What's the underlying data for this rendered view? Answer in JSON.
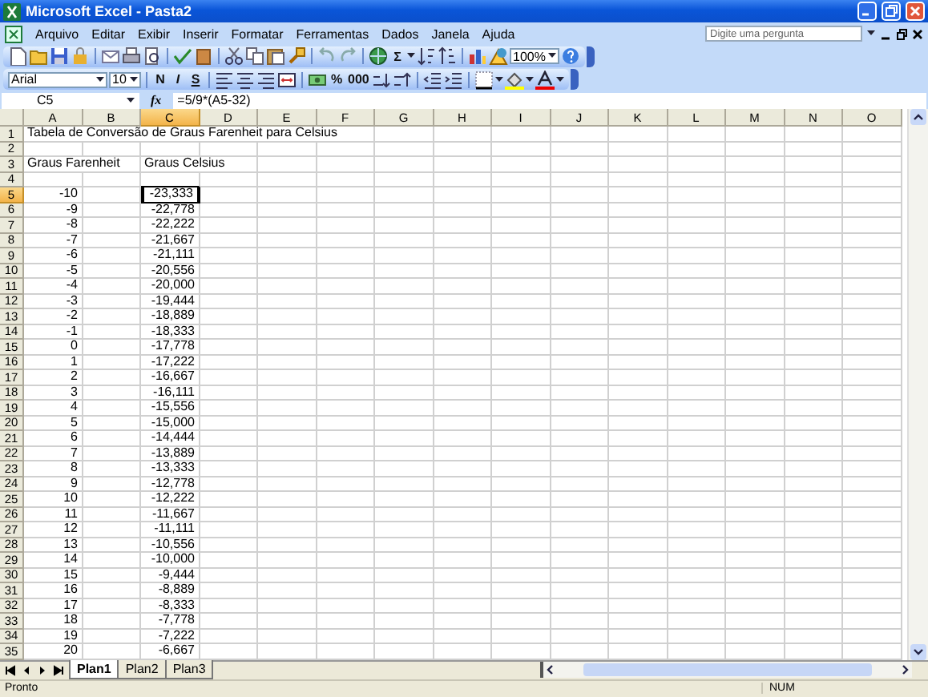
{
  "window": {
    "title": "Microsoft Excel - Pasta2"
  },
  "menu": [
    {
      "label": "Arquivo"
    },
    {
      "label": "Editar"
    },
    {
      "label": "Exibir"
    },
    {
      "label": "Inserir"
    },
    {
      "label": "Formatar"
    },
    {
      "label": "Ferramentas"
    },
    {
      "label": "Dados"
    },
    {
      "label": "Janela"
    },
    {
      "label": "Ajuda"
    }
  ],
  "help_box": {
    "placeholder": "Digite uma pergunta"
  },
  "standard_toolbar": {
    "sum": "Σ",
    "zoom": "100%"
  },
  "formatting_toolbar": {
    "font": "Arial",
    "size": "10",
    "bold": "N",
    "italic": "I",
    "underline": "S",
    "percent": "%",
    "thousands": "000"
  },
  "formula_bar": {
    "name_box": "C5",
    "fx": "fx",
    "formula": "=5/9*(A5-32)"
  },
  "sheet": {
    "columns": [
      {
        "label": "A",
        "selected": false
      },
      {
        "label": "B",
        "selected": false
      },
      {
        "label": "C",
        "selected": true
      },
      {
        "label": "D",
        "selected": false
      },
      {
        "label": "E",
        "selected": false
      },
      {
        "label": "F",
        "selected": false
      },
      {
        "label": "G",
        "selected": false
      },
      {
        "label": "H",
        "selected": false
      },
      {
        "label": "I",
        "selected": false
      },
      {
        "label": "J",
        "selected": false
      },
      {
        "label": "K",
        "selected": false
      },
      {
        "label": "L",
        "selected": false
      },
      {
        "label": "M",
        "selected": false
      },
      {
        "label": "N",
        "selected": false
      },
      {
        "label": "O",
        "selected": false
      }
    ],
    "rows": [
      {
        "label": "1",
        "selected": false,
        "cells": {
          "A": {
            "text": "Tabela de Conversão de Graus Farenheit para Celsius",
            "kind": "text"
          }
        }
      },
      {
        "label": "2",
        "selected": false
      },
      {
        "label": "3",
        "selected": false,
        "cells": {
          "A": {
            "text": "Graus Farenheit",
            "kind": "text"
          },
          "C": {
            "text": "Graus Celsius",
            "kind": "text"
          }
        }
      },
      {
        "label": "4",
        "selected": false
      },
      {
        "label": "5",
        "selected": true,
        "cells": {
          "A": {
            "text": "-10",
            "kind": "number"
          },
          "C": {
            "text": "-23,333",
            "kind": "number"
          }
        }
      },
      {
        "label": "6",
        "selected": false,
        "cells": {
          "A": {
            "text": "-9",
            "kind": "number"
          },
          "C": {
            "text": "-22,778",
            "kind": "number"
          }
        }
      },
      {
        "label": "7",
        "selected": false,
        "cells": {
          "A": {
            "text": "-8",
            "kind": "number"
          },
          "C": {
            "text": "-22,222",
            "kind": "number"
          }
        }
      },
      {
        "label": "8",
        "selected": false,
        "cells": {
          "A": {
            "text": "-7",
            "kind": "number"
          },
          "C": {
            "text": "-21,667",
            "kind": "number"
          }
        }
      },
      {
        "label": "9",
        "selected": false,
        "cells": {
          "A": {
            "text": "-6",
            "kind": "number"
          },
          "C": {
            "text": "-21,111",
            "kind": "number"
          }
        }
      },
      {
        "label": "10",
        "selected": false,
        "cells": {
          "A": {
            "text": "-5",
            "kind": "number"
          },
          "C": {
            "text": "-20,556",
            "kind": "number"
          }
        }
      },
      {
        "label": "11",
        "selected": false,
        "cells": {
          "A": {
            "text": "-4",
            "kind": "number"
          },
          "C": {
            "text": "-20,000",
            "kind": "number"
          }
        }
      },
      {
        "label": "12",
        "selected": false,
        "cells": {
          "A": {
            "text": "-3",
            "kind": "number"
          },
          "C": {
            "text": "-19,444",
            "kind": "number"
          }
        }
      },
      {
        "label": "13",
        "selected": false,
        "cells": {
          "A": {
            "text": "-2",
            "kind": "number"
          },
          "C": {
            "text": "-18,889",
            "kind": "number"
          }
        }
      },
      {
        "label": "14",
        "selected": false,
        "cells": {
          "A": {
            "text": "-1",
            "kind": "number"
          },
          "C": {
            "text": "-18,333",
            "kind": "number"
          }
        }
      },
      {
        "label": "15",
        "selected": false,
        "cells": {
          "A": {
            "text": "0",
            "kind": "number"
          },
          "C": {
            "text": "-17,778",
            "kind": "number"
          }
        }
      },
      {
        "label": "16",
        "selected": false,
        "cells": {
          "A": {
            "text": "1",
            "kind": "number"
          },
          "C": {
            "text": "-17,222",
            "kind": "number"
          }
        }
      },
      {
        "label": "17",
        "selected": false,
        "cells": {
          "A": {
            "text": "2",
            "kind": "number"
          },
          "C": {
            "text": "-16,667",
            "kind": "number"
          }
        }
      },
      {
        "label": "18",
        "selected": false,
        "cells": {
          "A": {
            "text": "3",
            "kind": "number"
          },
          "C": {
            "text": "-16,111",
            "kind": "number"
          }
        }
      },
      {
        "label": "19",
        "selected": false,
        "cells": {
          "A": {
            "text": "4",
            "kind": "number"
          },
          "C": {
            "text": "-15,556",
            "kind": "number"
          }
        }
      },
      {
        "label": "20",
        "selected": false,
        "cells": {
          "A": {
            "text": "5",
            "kind": "number"
          },
          "C": {
            "text": "-15,000",
            "kind": "number"
          }
        }
      },
      {
        "label": "21",
        "selected": false,
        "cells": {
          "A": {
            "text": "6",
            "kind": "number"
          },
          "C": {
            "text": "-14,444",
            "kind": "number"
          }
        }
      },
      {
        "label": "22",
        "selected": false,
        "cells": {
          "A": {
            "text": "7",
            "kind": "number"
          },
          "C": {
            "text": "-13,889",
            "kind": "number"
          }
        }
      },
      {
        "label": "23",
        "selected": false,
        "cells": {
          "A": {
            "text": "8",
            "kind": "number"
          },
          "C": {
            "text": "-13,333",
            "kind": "number"
          }
        }
      },
      {
        "label": "24",
        "selected": false,
        "cells": {
          "A": {
            "text": "9",
            "kind": "number"
          },
          "C": {
            "text": "-12,778",
            "kind": "number"
          }
        }
      },
      {
        "label": "25",
        "selected": false,
        "cells": {
          "A": {
            "text": "10",
            "kind": "number"
          },
          "C": {
            "text": "-12,222",
            "kind": "number"
          }
        }
      },
      {
        "label": "26",
        "selected": false,
        "cells": {
          "A": {
            "text": "11",
            "kind": "number"
          },
          "C": {
            "text": "-11,667",
            "kind": "number"
          }
        }
      },
      {
        "label": "27",
        "selected": false,
        "cells": {
          "A": {
            "text": "12",
            "kind": "number"
          },
          "C": {
            "text": "-11,111",
            "kind": "number"
          }
        }
      },
      {
        "label": "28",
        "selected": false,
        "cells": {
          "A": {
            "text": "13",
            "kind": "number"
          },
          "C": {
            "text": "-10,556",
            "kind": "number"
          }
        }
      },
      {
        "label": "29",
        "selected": false,
        "cells": {
          "A": {
            "text": "14",
            "kind": "number"
          },
          "C": {
            "text": "-10,000",
            "kind": "number"
          }
        }
      },
      {
        "label": "30",
        "selected": false,
        "cells": {
          "A": {
            "text": "15",
            "kind": "number"
          },
          "C": {
            "text": "-9,444",
            "kind": "number"
          }
        }
      },
      {
        "label": "31",
        "selected": false,
        "cells": {
          "A": {
            "text": "16",
            "kind": "number"
          },
          "C": {
            "text": "-8,889",
            "kind": "number"
          }
        }
      },
      {
        "label": "32",
        "selected": false,
        "cells": {
          "A": {
            "text": "17",
            "kind": "number"
          },
          "C": {
            "text": "-8,333",
            "kind": "number"
          }
        }
      },
      {
        "label": "33",
        "selected": false,
        "cells": {
          "A": {
            "text": "18",
            "kind": "number"
          },
          "C": {
            "text": "-7,778",
            "kind": "number"
          }
        }
      },
      {
        "label": "34",
        "selected": false,
        "cells": {
          "A": {
            "text": "19",
            "kind": "number"
          },
          "C": {
            "text": "-7,222",
            "kind": "number"
          }
        }
      },
      {
        "label": "35",
        "selected": false,
        "cells": {
          "A": {
            "text": "20",
            "kind": "number"
          },
          "C": {
            "text": "-6,667",
            "kind": "number"
          }
        }
      }
    ]
  },
  "sheet_tabs": [
    {
      "label": "Plan1",
      "selected": true
    },
    {
      "label": "Plan2",
      "selected": false
    },
    {
      "label": "Plan3",
      "selected": false
    }
  ],
  "status_bar": {
    "status": "Pronto",
    "indicator": "NUM"
  }
}
